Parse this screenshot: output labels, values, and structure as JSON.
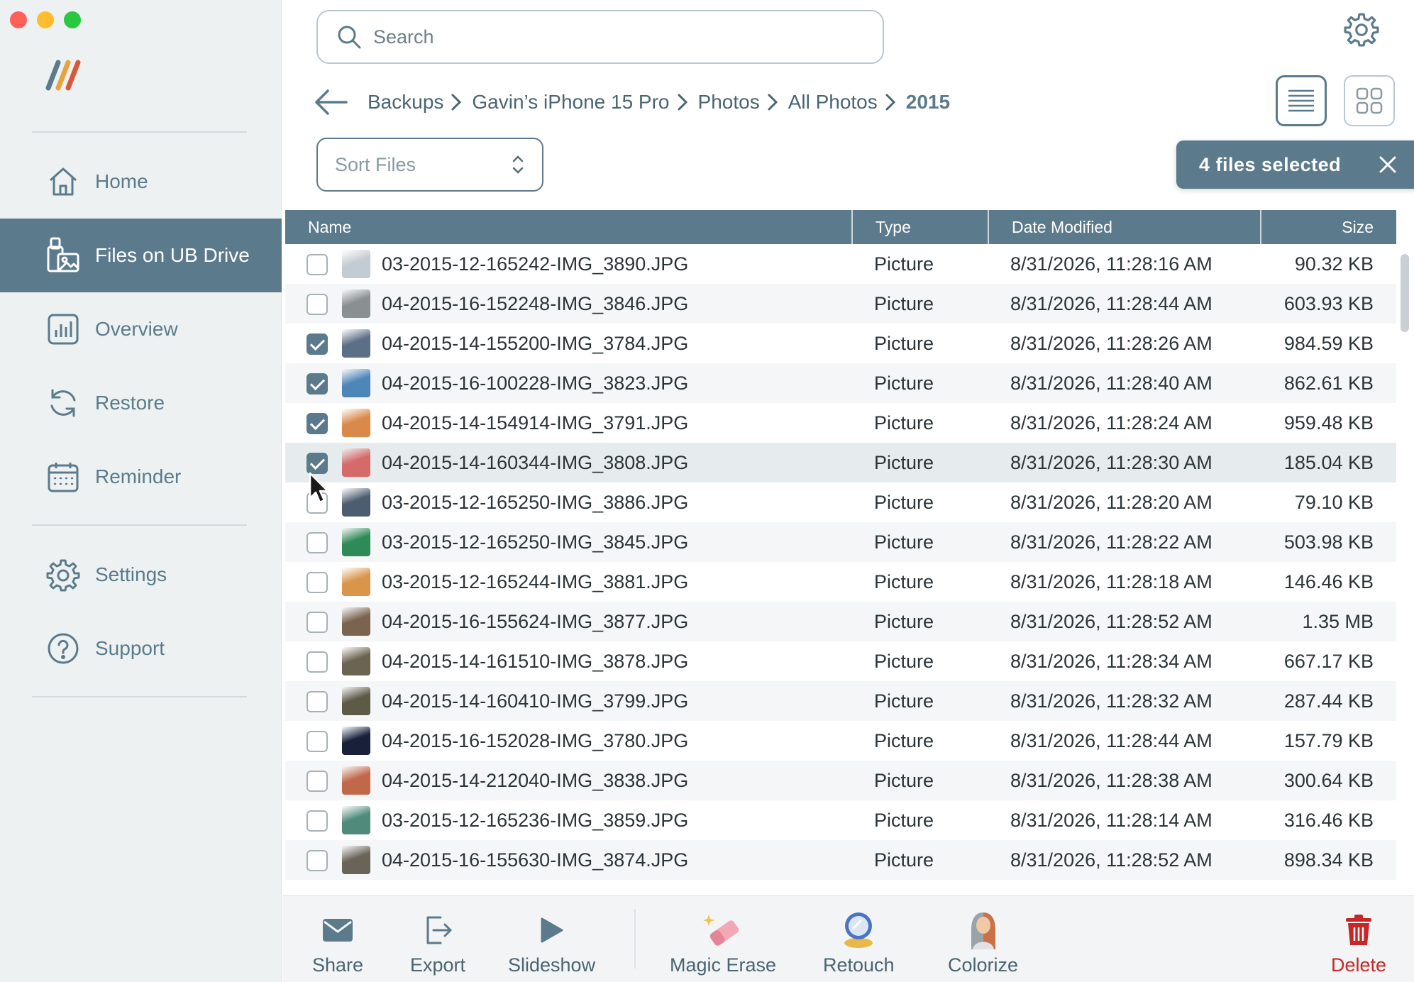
{
  "window": {
    "controls": [
      "close",
      "minimize",
      "zoom"
    ]
  },
  "sidebar": {
    "items": [
      {
        "label": "Home",
        "icon": "home-icon",
        "active": false
      },
      {
        "label": "Files on UB Drive",
        "icon": "files-icon",
        "active": true
      },
      {
        "label": "Overview",
        "icon": "chart-icon",
        "active": false
      },
      {
        "label": "Restore",
        "icon": "restore-icon",
        "active": false
      },
      {
        "label": "Reminder",
        "icon": "calendar-icon",
        "active": false
      },
      {
        "label": "Settings",
        "icon": "gear-icon",
        "active": false
      },
      {
        "label": "Support",
        "icon": "help-icon",
        "active": false
      }
    ]
  },
  "search": {
    "placeholder": "Search",
    "value": ""
  },
  "breadcrumb": [
    "Backups",
    "Gavin’s iPhone 15 Pro",
    "Photos",
    "All Photos",
    "2015"
  ],
  "sort": {
    "placeholder": "Sort Files"
  },
  "selection": {
    "text": "4 files selected"
  },
  "table": {
    "columns": [
      "Name",
      "Type",
      "Date Modified",
      "Size"
    ],
    "rows": [
      {
        "checked": false,
        "name": "03-2015-12-165242-IMG_3890.JPG",
        "type": "Picture",
        "date": "8/31/2026, 11:28:16 AM",
        "size": "90.32 KB",
        "thumb": "#c3ccd2"
      },
      {
        "checked": false,
        "name": "04-2015-16-152248-IMG_3846.JPG",
        "type": "Picture",
        "date": "8/31/2026, 11:28:44 AM",
        "size": "603.93 KB",
        "thumb": "#8a8f92"
      },
      {
        "checked": true,
        "name": "04-2015-14-155200-IMG_3784.JPG",
        "type": "Picture",
        "date": "8/31/2026, 11:28:26 AM",
        "size": "984.59 KB",
        "thumb": "#5d6f86"
      },
      {
        "checked": true,
        "name": "04-2015-16-100228-IMG_3823.JPG",
        "type": "Picture",
        "date": "8/31/2026, 11:28:40 AM",
        "size": "862.61 KB",
        "thumb": "#4f86b8"
      },
      {
        "checked": true,
        "name": "04-2015-14-154914-IMG_3791.JPG",
        "type": "Picture",
        "date": "8/31/2026, 11:28:24 AM",
        "size": "959.48 KB",
        "thumb": "#d98a4a"
      },
      {
        "checked": true,
        "name": "04-2015-14-160344-IMG_3808.JPG",
        "type": "Picture",
        "date": "8/31/2026, 11:28:30 AM",
        "size": "185.04 KB",
        "thumb": "#d46a6a"
      },
      {
        "checked": false,
        "name": "03-2015-12-165250-IMG_3886.JPG",
        "type": "Picture",
        "date": "8/31/2026, 11:28:20 AM",
        "size": "79.10 KB",
        "thumb": "#4d5d70"
      },
      {
        "checked": false,
        "name": "03-2015-12-165250-IMG_3845.JPG",
        "type": "Picture",
        "date": "8/31/2026, 11:28:22 AM",
        "size": "503.98 KB",
        "thumb": "#2e8a56"
      },
      {
        "checked": false,
        "name": "03-2015-12-165244-IMG_3881.JPG",
        "type": "Picture",
        "date": "8/31/2026, 11:28:18 AM",
        "size": "146.46 KB",
        "thumb": "#d9954a"
      },
      {
        "checked": false,
        "name": "04-2015-16-155624-IMG_3877.JPG",
        "type": "Picture",
        "date": "8/31/2026, 11:28:52 AM",
        "size": "1.35 MB",
        "thumb": "#7a6450"
      },
      {
        "checked": false,
        "name": "04-2015-14-161510-IMG_3878.JPG",
        "type": "Picture",
        "date": "8/31/2026, 11:28:34 AM",
        "size": "667.17 KB",
        "thumb": "#6b6450"
      },
      {
        "checked": false,
        "name": "04-2015-14-160410-IMG_3799.JPG",
        "type": "Picture",
        "date": "8/31/2026, 11:28:32 AM",
        "size": "287.44 KB",
        "thumb": "#5e5a48"
      },
      {
        "checked": false,
        "name": "04-2015-16-152028-IMG_3780.JPG",
        "type": "Picture",
        "date": "8/31/2026, 11:28:44 AM",
        "size": "157.79 KB",
        "thumb": "#18203a"
      },
      {
        "checked": false,
        "name": "04-2015-14-212040-IMG_3838.JPG",
        "type": "Picture",
        "date": "8/31/2026, 11:28:38 AM",
        "size": "300.64 KB",
        "thumb": "#c0684a"
      },
      {
        "checked": false,
        "name": "03-2015-12-165236-IMG_3859.JPG",
        "type": "Picture",
        "date": "8/31/2026, 11:28:14 AM",
        "size": "316.46 KB",
        "thumb": "#4f8a7a"
      },
      {
        "checked": false,
        "name": "04-2015-16-155630-IMG_3874.JPG",
        "type": "Picture",
        "date": "8/31/2026, 11:28:52 AM",
        "size": "898.34 KB",
        "thumb": "#6a6458"
      }
    ]
  },
  "toolbar": {
    "share": "Share",
    "export": "Export",
    "slideshow": "Slideshow",
    "magic_erase": "Magic Erase",
    "retouch": "Retouch",
    "colorize": "Colorize",
    "delete": "Delete"
  },
  "colors": {
    "accent": "#5b7a8c",
    "sidebar_bg": "#edf1f1",
    "delete": "#c62828"
  }
}
